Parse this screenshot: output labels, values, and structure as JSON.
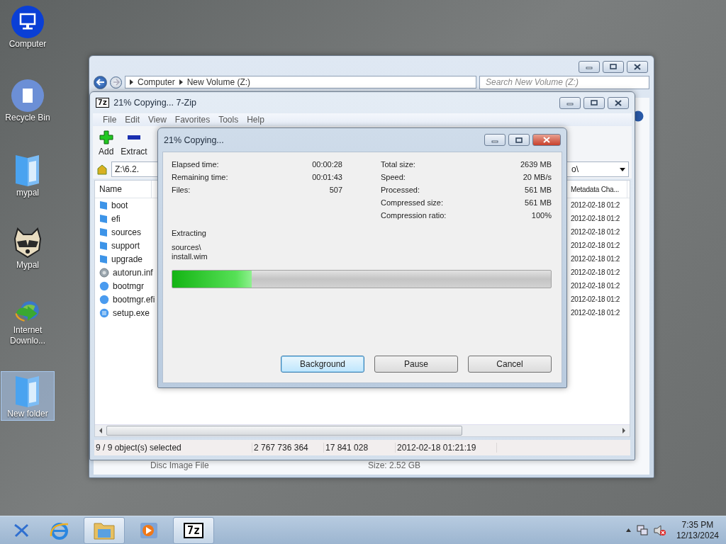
{
  "desktop_icons": [
    {
      "label": "Computer",
      "kind": "computer",
      "selected": false
    },
    {
      "label": "Recycle Bin",
      "kind": "bin",
      "selected": false
    },
    {
      "label": "mypal",
      "kind": "folder",
      "selected": false
    },
    {
      "label": "Mypal",
      "kind": "raccoon",
      "selected": false
    },
    {
      "label": "Internet Downlo...",
      "kind": "downloader",
      "selected": false
    },
    {
      "label": "New folder",
      "kind": "folder",
      "selected": true
    }
  ],
  "explorer": {
    "address": [
      "Computer",
      "New Volume (Z:)"
    ],
    "search": {
      "placeholder": "Search New Volume (Z:)"
    },
    "details": {
      "type": "Disc Image File",
      "size": "Size: 2.52 GB"
    }
  },
  "sevenzip": {
    "title": "21% Copying... 7-Zip",
    "app_icon": "7z",
    "menu": [
      "File",
      "Edit",
      "View",
      "Favorites",
      "Tools",
      "Help"
    ],
    "toolbar": [
      {
        "label": "Add",
        "kind": "add"
      },
      {
        "label": "Extract",
        "kind": "extract"
      }
    ],
    "address_start": "Z:\\6.2.",
    "address_end": "o\\",
    "columns": {
      "name": "Name",
      "metadata": "Metadata Cha..."
    },
    "files": [
      {
        "name": "boot",
        "kind": "folder",
        "date": "2012-02-18 01:2"
      },
      {
        "name": "efi",
        "kind": "folder",
        "date": "2012-02-18 01:2"
      },
      {
        "name": "sources",
        "kind": "folder",
        "date": "2012-02-18 01:2"
      },
      {
        "name": "support",
        "kind": "folder",
        "date": "2012-02-18 01:2"
      },
      {
        "name": "upgrade",
        "kind": "folder",
        "date": "2012-02-18 01:2"
      },
      {
        "name": "autorun.inf",
        "kind": "settings",
        "date": "2012-02-18 01:2"
      },
      {
        "name": "bootmgr",
        "kind": "system",
        "date": "2012-02-18 01:2"
      },
      {
        "name": "bootmgr.efi",
        "kind": "system",
        "date": "2012-02-18 01:2"
      },
      {
        "name": "setup.exe",
        "kind": "app",
        "date": "2012-02-18 01:2"
      }
    ],
    "status": [
      "9 / 9 object(s) selected",
      "2 767 736 364",
      "17 841 028",
      "2012-02-18 01:21:19"
    ]
  },
  "dialog": {
    "title": "21% Copying...",
    "left_stats": [
      {
        "label": "Elapsed time:",
        "value": "00:00:28"
      },
      {
        "label": "Remaining time:",
        "value": "00:01:43"
      },
      {
        "label": "Files:",
        "value": "507"
      }
    ],
    "right_stats": [
      {
        "label": "Total size:",
        "value": "2639 MB"
      },
      {
        "label": "Speed:",
        "value": "20 MB/s"
      },
      {
        "label": "Processed:",
        "value": "561 MB"
      },
      {
        "label": "Compressed size:",
        "value": "561 MB"
      },
      {
        "label": "Compression ratio:",
        "value": "100%"
      }
    ],
    "operation": "Extracting",
    "path": [
      "sources\\",
      "install.wim"
    ],
    "progress": {
      "level": 0.21
    },
    "buttons": [
      {
        "label": "Background",
        "default": true
      },
      {
        "label": "Pause",
        "default": false
      },
      {
        "label": "Cancel",
        "default": false
      }
    ]
  },
  "taskbar": {
    "apps": [
      {
        "kind": "start",
        "open": false
      },
      {
        "kind": "browser",
        "open": false
      },
      {
        "kind": "explorer",
        "open": true
      },
      {
        "kind": "media",
        "open": false
      },
      {
        "kind": "archiver",
        "open": true,
        "label": "7z"
      }
    ],
    "clock": {
      "time": "7:35 PM",
      "date": "12/13/2024"
    }
  }
}
